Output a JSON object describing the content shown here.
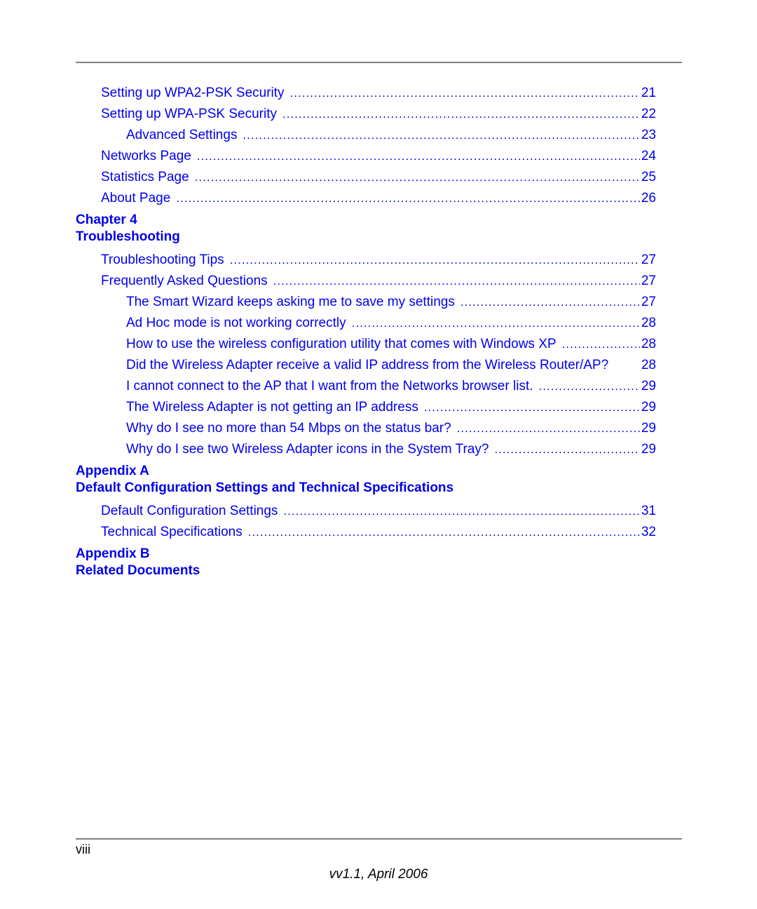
{
  "toc": {
    "group0": {
      "entries": [
        {
          "title": "Setting up WPA2-PSK Security",
          "page": "21"
        },
        {
          "title": "Setting up WPA-PSK Security",
          "page": "22"
        },
        {
          "title": "Advanced Settings",
          "page": "23"
        },
        {
          "title": "Networks Page",
          "page": "24"
        },
        {
          "title": "Statistics Page",
          "page": "25"
        },
        {
          "title": "About Page",
          "page": "26"
        }
      ]
    },
    "chapter4": {
      "label": "Chapter 4",
      "title": "Troubleshooting",
      "entries": [
        {
          "title": "Troubleshooting Tips",
          "page": "27"
        },
        {
          "title": "Frequently Asked Questions",
          "page": "27"
        },
        {
          "title": "The Smart Wizard keeps asking me to save my settings",
          "page": "27"
        },
        {
          "title": "Ad Hoc mode is not working correctly",
          "page": "28"
        },
        {
          "title": "How to use the wireless configuration utility that comes with Windows XP",
          "page": "28"
        },
        {
          "title": "Did the Wireless Adapter receive a valid IP address from the Wireless Router/AP?",
          "page": "28"
        },
        {
          "title": "I cannot connect to the AP that I want from the Networks browser list.",
          "page": "29"
        },
        {
          "title": "The Wireless Adapter is not getting an IP address",
          "page": "29"
        },
        {
          "title": "Why do I see no more than 54 Mbps on the status bar?",
          "page": "29"
        },
        {
          "title": "Why do I see two Wireless Adapter icons in the System Tray?",
          "page": "29"
        }
      ]
    },
    "appendixA": {
      "label": "Appendix A",
      "title": "Default Configuration Settings and Technical Specifications",
      "entries": [
        {
          "title": "Default Configuration Settings",
          "page": "31"
        },
        {
          "title": "Technical Specifications",
          "page": "32"
        }
      ]
    },
    "appendixB": {
      "label": "Appendix B",
      "title": "Related Documents"
    }
  },
  "footer": {
    "page_number": "viii",
    "version": "vv1.1, April 2006"
  },
  "colors": {
    "link": "#0000ee",
    "rule": "#808080"
  }
}
